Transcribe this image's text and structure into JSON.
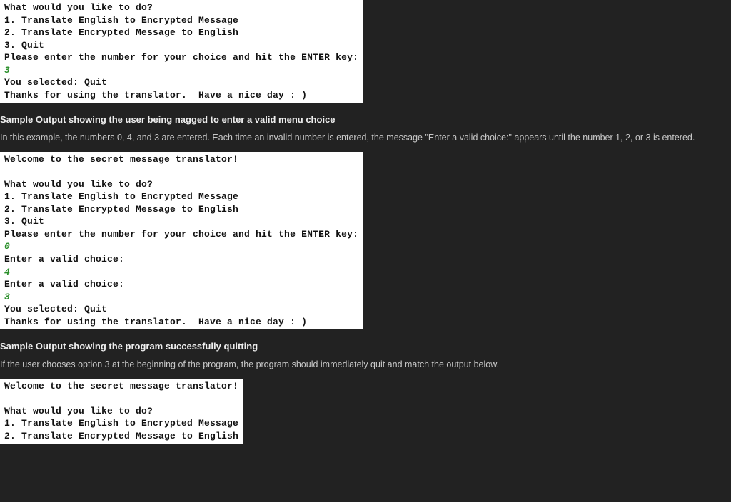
{
  "console1": {
    "l0": "What would you like to do?",
    "l1": "1. Translate English to Encrypted Message",
    "l2": "2. Translate Encrypted Message to English",
    "l3": "3. Quit",
    "l4": "Please enter the number for your choice and hit the ENTER key:",
    "l5": "3",
    "l6": "You selected: Quit",
    "l7": "Thanks for using the translator.  Have a nice day : )"
  },
  "section1": {
    "heading": "Sample Output showing the user being nagged to enter a valid menu choice",
    "para": "In this example, the numbers 0, 4, and 3 are entered. Each time an invalid number is entered, the message \"Enter a valid choice:\" appears until the number 1, 2, or 3 is entered."
  },
  "console2": {
    "l0": "Welcome to the secret message translator!",
    "lblank": " ",
    "l1": "What would you like to do?",
    "l2": "1. Translate English to Encrypted Message",
    "l3": "2. Translate Encrypted Message to English",
    "l4": "3. Quit",
    "l5": "Please enter the number for your choice and hit the ENTER key:",
    "l6": "0",
    "l7": "Enter a valid choice:",
    "l8": "4",
    "l9": "Enter a valid choice:",
    "l10": "3",
    "l11": "You selected: Quit",
    "l12": "Thanks for using the translator.  Have a nice day : )"
  },
  "section2": {
    "heading": "Sample Output showing the program successfully quitting",
    "para": "If the user chooses option 3 at the beginning of the program, the program should immediately quit and match the output below."
  },
  "console3": {
    "l0": "Welcome to the secret message translator!",
    "lblank": " ",
    "l1": "What would you like to do?",
    "l2": "1. Translate English to Encrypted Message",
    "l3": "2. Translate Encrypted Message to English"
  }
}
